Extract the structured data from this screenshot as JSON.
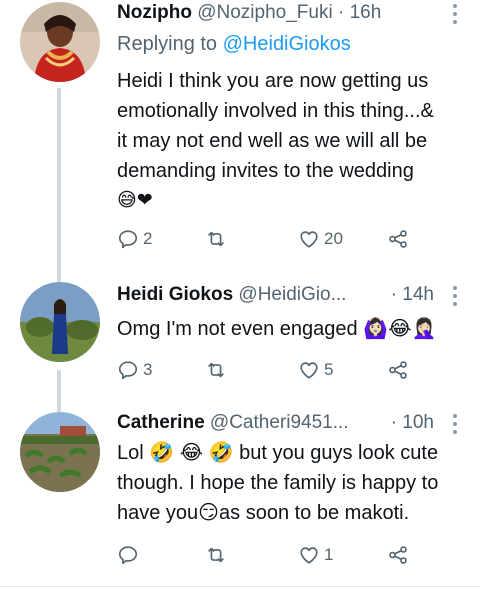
{
  "tweets": [
    {
      "name": "Nozipho",
      "handle": "@Nozipho_Fuki",
      "time": "· 16h",
      "reply_prefix": "Replying to",
      "reply_handle": "@HeidiGiokos",
      "text_lines": [
        "Heidi I think you are now getting us",
        "emotionally involved in this thing...&",
        "it may not end well as we will all be",
        "demanding invites to the wedding"
      ],
      "emoji_line": "😅❤",
      "replies": "2",
      "retweets": "",
      "likes": "20"
    },
    {
      "name": "Heidi Giokos",
      "handle": "@HeidiGio...",
      "time": "· 14h",
      "text": "Omg I'm not even engaged 🙆🏻‍♀️😂🤦🏻‍♀️",
      "replies": "3",
      "retweets": "",
      "likes": "5"
    },
    {
      "name": "Catherine",
      "handle": "@Catheri9451...",
      "time": "· 10h",
      "text_lines": [
        "Lol 🤣 😂 🤣 but you guys look cute",
        "though. I hope the family is happy to",
        "have you😏as soon to be makoti."
      ],
      "replies": "",
      "retweets": "",
      "likes": "1"
    }
  ],
  "icons": [
    "reply-icon",
    "retweet-icon",
    "like-icon",
    "share-icon",
    "more-icon"
  ],
  "colors": {
    "text": "#0f1419",
    "secondary": "#536471",
    "link": "#1d9bf0",
    "thread_line": "#cfd9de"
  }
}
